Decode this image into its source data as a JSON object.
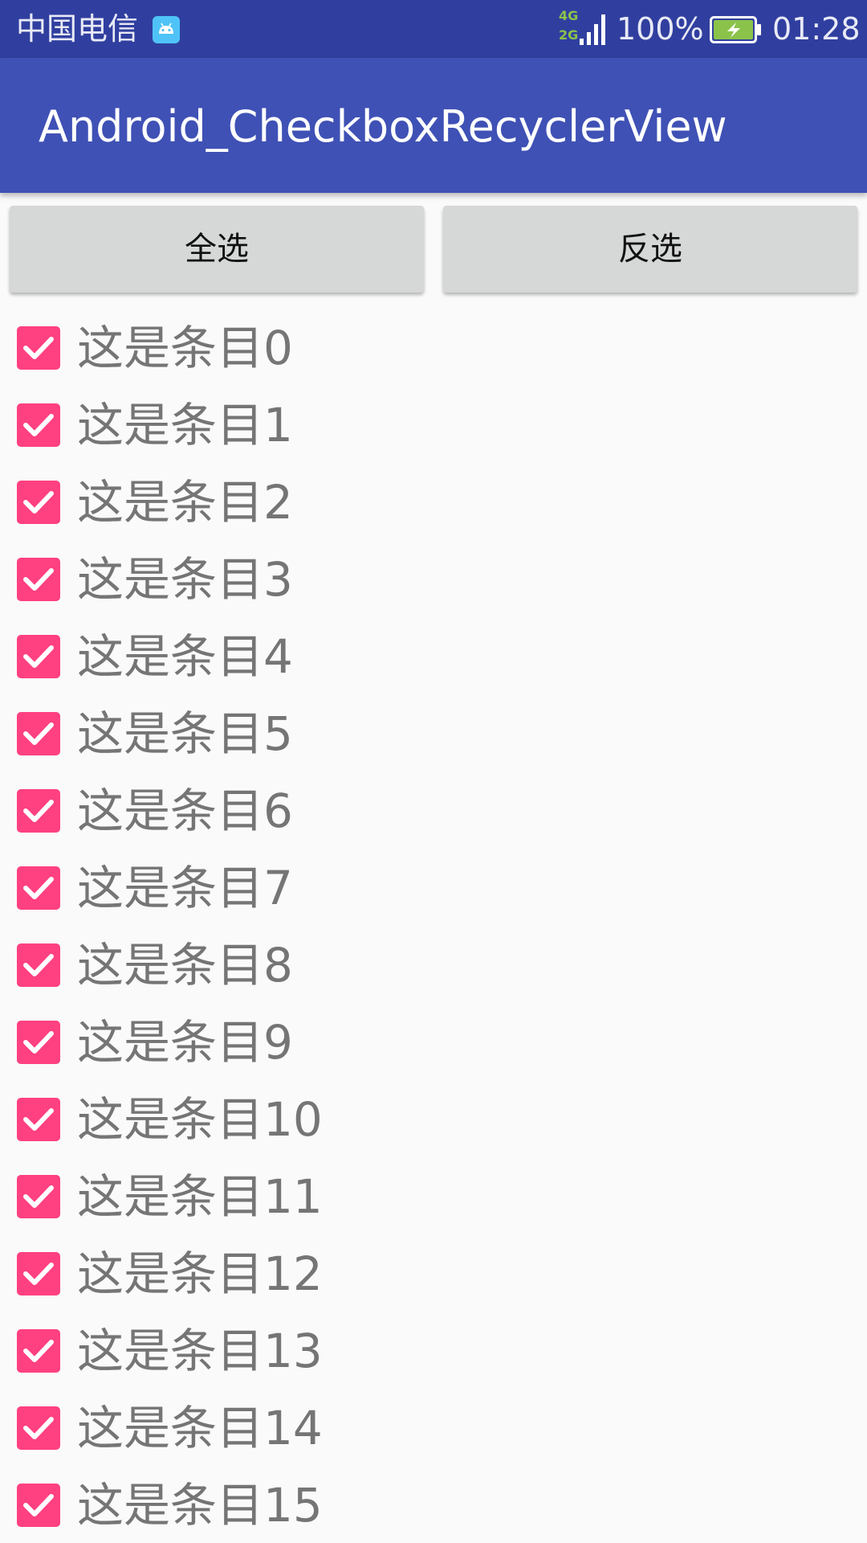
{
  "status_bar": {
    "carrier": "中国电信",
    "network_top": "4G",
    "network_bottom": "2G",
    "battery_percent": "100%",
    "time": "01:28",
    "icons": [
      "android-debug-icon",
      "signal-icon",
      "battery-charging-icon"
    ]
  },
  "app_bar": {
    "title": "Android_CheckboxRecyclerView",
    "color": "#3f51b5",
    "status_color": "#303f9f"
  },
  "buttons": {
    "select_all": "全选",
    "invert": "反选"
  },
  "list": {
    "accent_color": "#ff4081",
    "items": [
      {
        "label": "这是条目0",
        "checked": true
      },
      {
        "label": "这是条目1",
        "checked": true
      },
      {
        "label": "这是条目2",
        "checked": true
      },
      {
        "label": "这是条目3",
        "checked": true
      },
      {
        "label": "这是条目4",
        "checked": true
      },
      {
        "label": "这是条目5",
        "checked": true
      },
      {
        "label": "这是条目6",
        "checked": true
      },
      {
        "label": "这是条目7",
        "checked": true
      },
      {
        "label": "这是条目8",
        "checked": true
      },
      {
        "label": "这是条目9",
        "checked": true
      },
      {
        "label": "这是条目10",
        "checked": true
      },
      {
        "label": "这是条目11",
        "checked": true
      },
      {
        "label": "这是条目12",
        "checked": true
      },
      {
        "label": "这是条目13",
        "checked": true
      },
      {
        "label": "这是条目14",
        "checked": true
      },
      {
        "label": "这是条目15",
        "checked": true
      }
    ]
  }
}
